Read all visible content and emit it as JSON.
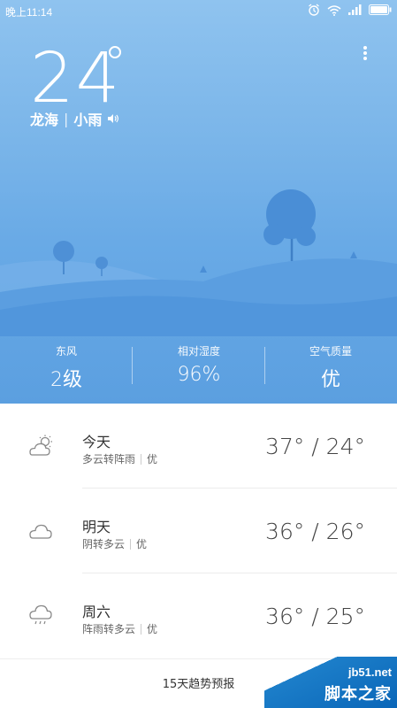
{
  "statusbar": {
    "time": "晚上11:14",
    "icons": [
      "alarm-icon",
      "wifi-icon",
      "signal-icon",
      "battery-icon"
    ]
  },
  "current": {
    "temperature": "24",
    "location": "龙海",
    "separator": "|",
    "condition": "小雨"
  },
  "stats": [
    {
      "label": "东风",
      "value": "2级"
    },
    {
      "label": "相对湿度",
      "value": "96%"
    },
    {
      "label": "空气质量",
      "value": "优"
    }
  ],
  "forecast": [
    {
      "day": "今天",
      "condition": "多云转阵雨",
      "aqi": "优",
      "temps": "37° / 24°",
      "icon": "partly-cloudy-icon"
    },
    {
      "day": "明天",
      "condition": "阴转多云",
      "aqi": "优",
      "temps": "36° / 26°",
      "icon": "cloud-icon"
    },
    {
      "day": "周六",
      "condition": "阵雨转多云",
      "aqi": "优",
      "temps": "36° / 25°",
      "icon": "rain-cloud-icon"
    }
  ],
  "bottom": {
    "link_label": "15天趋势预报"
  },
  "watermark": {
    "url": "jb51.net",
    "name": "脚本之家"
  },
  "colors": {
    "sky_top": "#8fc3ef",
    "sky_bottom": "#5b9fe0",
    "hill": "#4f8fd4"
  }
}
